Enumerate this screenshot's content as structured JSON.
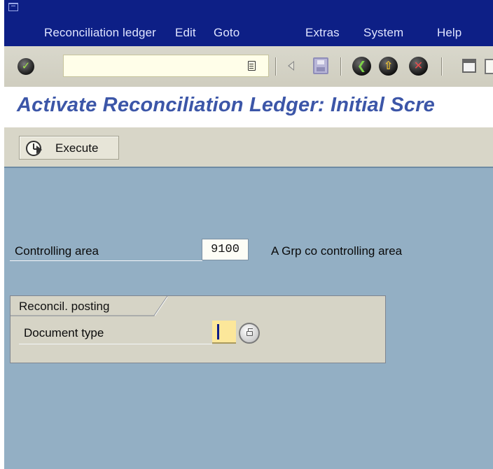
{
  "menubar": {
    "items": [
      {
        "label": "Reconciliation ledger"
      },
      {
        "label": "Edit"
      },
      {
        "label": "Goto"
      },
      {
        "label": "Extras"
      },
      {
        "label": "System"
      },
      {
        "label": "Help"
      }
    ],
    "color": "#0d1f86"
  },
  "toolbar": {
    "command_value": "",
    "icons": [
      "enter-checkmark-icon",
      "command-history-icon",
      "back-triangle-icon",
      "save-icon",
      "back-icon",
      "exit-icon",
      "cancel-icon",
      "print-icon",
      "find-icon"
    ]
  },
  "header": {
    "title": "Activate Reconciliation Ledger: Initial Scre",
    "title_color": "#3c56a8"
  },
  "app_toolbar": {
    "execute_label": "Execute"
  },
  "form": {
    "controlling_area": {
      "label": "Controlling area",
      "value": "9100",
      "description": "A Grp co controlling area"
    },
    "reconcil_group": {
      "title": "Reconcil. posting",
      "document_type": {
        "label": "Document type",
        "value": ""
      }
    }
  },
  "colors": {
    "background": "#93afc4",
    "toolbar": "#d8d6c8",
    "required_field": "#fce79a"
  }
}
